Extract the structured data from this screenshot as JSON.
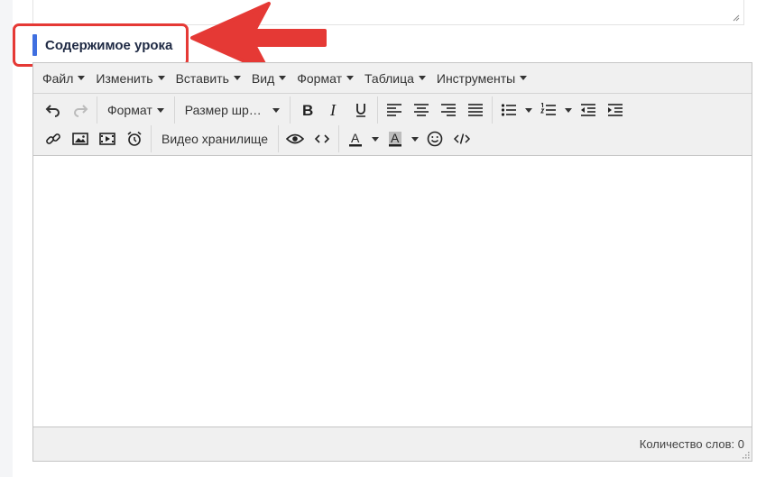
{
  "section": {
    "title": "Содержимое урока"
  },
  "menubar": [
    {
      "label": "Файл"
    },
    {
      "label": "Изменить"
    },
    {
      "label": "Вставить"
    },
    {
      "label": "Вид"
    },
    {
      "label": "Формат"
    },
    {
      "label": "Таблица"
    },
    {
      "label": "Инструменты"
    }
  ],
  "toolbar": {
    "format_label": "Формат",
    "font_size_label": "Размер шр…",
    "video_storage_label": "Видео хранилище",
    "text_color_letter": "A",
    "bg_color_letter": "A"
  },
  "status": {
    "word_count": "Количество слов: 0"
  },
  "colors": {
    "accent_bar": "#3f6fe0",
    "highlight": "#e53935",
    "arrow": "#e53935"
  },
  "icons": [
    "undo-icon",
    "redo-icon",
    "bold-icon",
    "italic-icon",
    "underline-icon",
    "align-left-icon",
    "align-center-icon",
    "align-right-icon",
    "align-justify-icon",
    "bullet-list-icon",
    "numbered-list-icon",
    "outdent-icon",
    "indent-icon",
    "link-icon",
    "image-icon",
    "media-icon",
    "alarm-icon",
    "preview-icon",
    "code-icon",
    "text-color-icon",
    "background-color-icon",
    "emoji-icon",
    "source-code-icon"
  ]
}
